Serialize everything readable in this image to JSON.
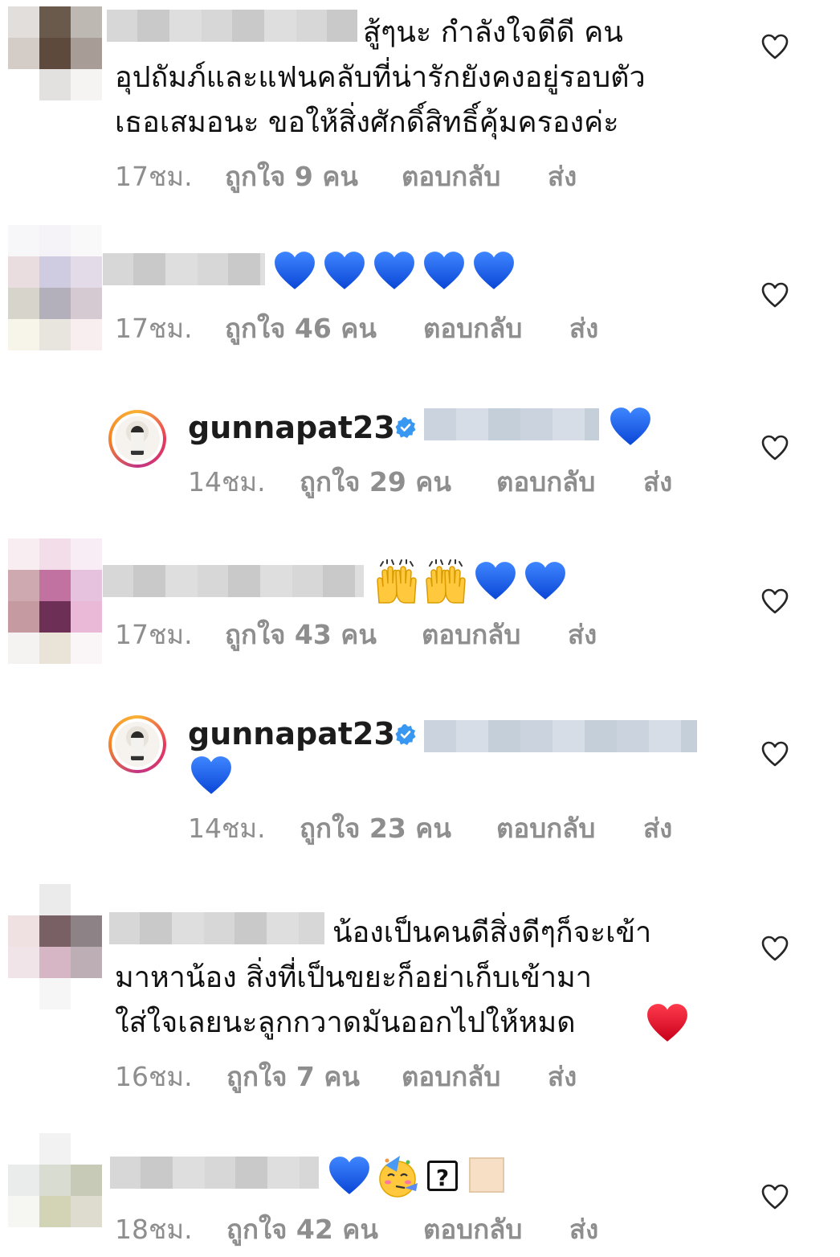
{
  "comments": [
    {
      "text_lines": [
        "สู้ๆนะ กำลังใจดีดี คน",
        "อุปถัมภ์และแฟนคลับที่น่ารักยังคงอยู่รอบตัว",
        "เธอเสมอนะ ขอให้สิ่งศักดิ์สิทธิ์คุ้มครองค่ะ"
      ],
      "time": "17ชม.",
      "likes": "ถูกใจ 9 คน",
      "reply": "ตอบกลับ",
      "send": "ส่ง"
    },
    {
      "emojis": [
        "blue-heart",
        "blue-heart",
        "blue-heart",
        "blue-heart",
        "blue-heart"
      ],
      "time": "17ชม.",
      "likes": "ถูกใจ 46 คน",
      "reply": "ตอบกลับ",
      "send": "ส่ง"
    },
    {
      "username": "gunnapat23",
      "verified": true,
      "emojis": [
        "blue-heart"
      ],
      "time": "14ชม.",
      "likes": "ถูกใจ 29 คน",
      "reply": "ตอบกลับ",
      "send": "ส่ง"
    },
    {
      "emojis": [
        "raising-hands",
        "raising-hands",
        "blue-heart",
        "blue-heart"
      ],
      "time": "17ชม.",
      "likes": "ถูกใจ 43 คน",
      "reply": "ตอบกลับ",
      "send": "ส่ง"
    },
    {
      "username": "gunnapat23",
      "verified": true,
      "emojis": [
        "blue-heart"
      ],
      "time": "14ชม.",
      "likes": "ถูกใจ 23 คน",
      "reply": "ตอบกลับ",
      "send": "ส่ง"
    },
    {
      "text_lines": [
        "น้องเป็นคนดีสิ่งดีๆก็จะเข้า",
        "มาหาน้อง สิ่งที่เป็นขยะก็อย่าเก็บเข้ามา",
        "ใส่ใจเลยนะลูกกวาดมันออกไปให้หมด"
      ],
      "emojis": [
        "red-heart"
      ],
      "time": "16ชม.",
      "likes": "ถูกใจ 7 คน",
      "reply": "ตอบกลับ",
      "send": "ส่ง"
    },
    {
      "emojis": [
        "blue-heart",
        "partying-face",
        "unknown-glyph",
        "skin-tone-box"
      ],
      "unknown_glyph": "?",
      "time": "18ชม.",
      "likes": "ถูกใจ 42 คน",
      "reply": "ตอบกลับ",
      "send": "ส่ง"
    }
  ],
  "colors": {
    "meta_text": "#8e8e8e",
    "blue_heart": "#1f63f0",
    "verified_badge": "#3897f0",
    "red_heart": "#e0112b"
  }
}
